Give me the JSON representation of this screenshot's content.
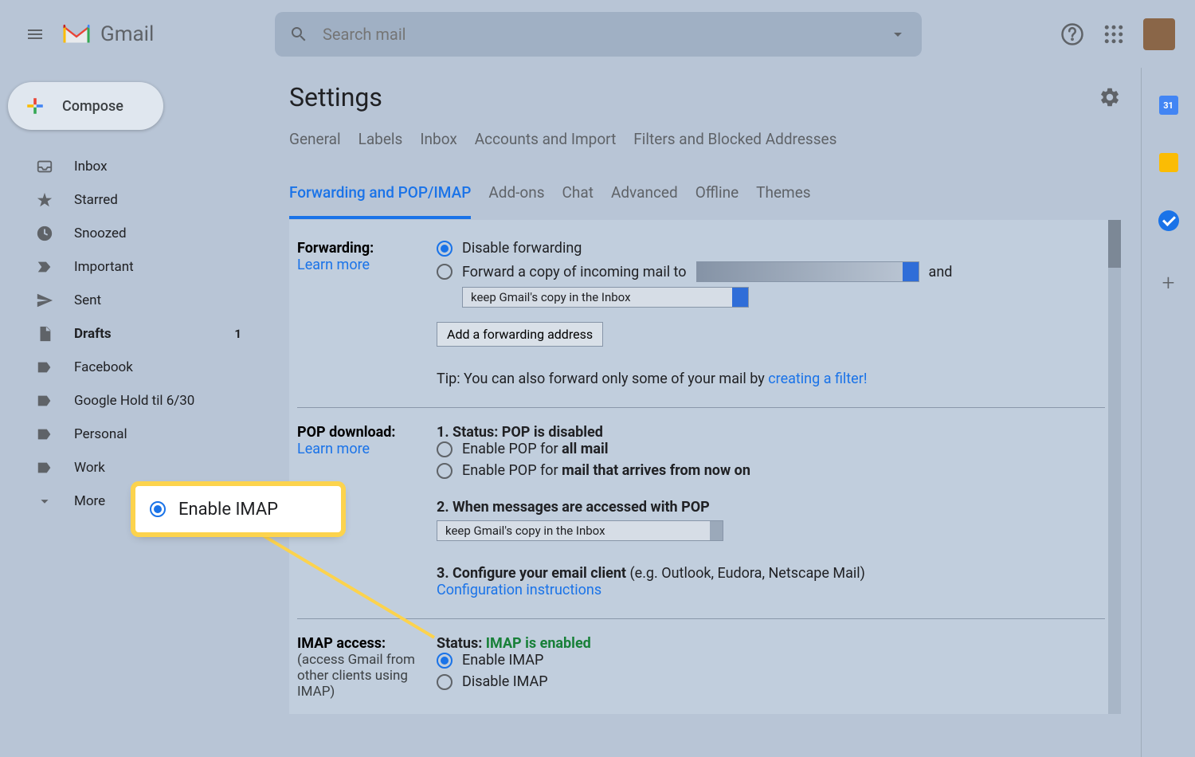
{
  "header": {
    "logo_text": "Gmail",
    "search_placeholder": "Search mail"
  },
  "sidebar": {
    "compose_label": "Compose",
    "items": [
      {
        "icon": "inbox",
        "label": "Inbox"
      },
      {
        "icon": "star",
        "label": "Starred"
      },
      {
        "icon": "clock",
        "label": "Snoozed"
      },
      {
        "icon": "important",
        "label": "Important"
      },
      {
        "icon": "sent",
        "label": "Sent"
      },
      {
        "icon": "drafts",
        "label": "Drafts",
        "count": "1",
        "bold": true
      },
      {
        "icon": "label",
        "label": "Facebook"
      },
      {
        "icon": "label",
        "label": "Google Hold til 6/30"
      },
      {
        "icon": "label",
        "label": "Personal"
      },
      {
        "icon": "label",
        "label": "Work"
      },
      {
        "icon": "chevron-down",
        "label": "More"
      }
    ]
  },
  "main": {
    "title": "Settings",
    "tabs": [
      {
        "label": "General"
      },
      {
        "label": "Labels"
      },
      {
        "label": "Inbox"
      },
      {
        "label": "Accounts and Import"
      },
      {
        "label": "Filters and Blocked Addresses"
      },
      {
        "label": "Forwarding and POP/IMAP",
        "active": true
      },
      {
        "label": "Add-ons"
      },
      {
        "label": "Chat"
      },
      {
        "label": "Advanced"
      },
      {
        "label": "Offline"
      },
      {
        "label": "Themes"
      }
    ]
  },
  "forwarding": {
    "heading": "Forwarding:",
    "learn_more": "Learn more",
    "disable_label": "Disable forwarding",
    "forward_copy_label_prefix": "Forward a copy of incoming mail to",
    "forward_and": "and",
    "keep_copy_label": "keep Gmail's copy in the Inbox",
    "add_address_btn": "Add a forwarding address",
    "tip_prefix": "Tip: You can also forward only some of your mail by ",
    "tip_link": "creating a filter!"
  },
  "pop": {
    "heading": "POP download:",
    "learn_more": "Learn more",
    "status_label": "1. Status: POP is disabled",
    "enable_all_prefix": "Enable POP for ",
    "enable_all_bold": "all mail",
    "enable_arrives_prefix": "Enable POP for ",
    "enable_arrives_bold": "mail that arrives from now on",
    "when_accessed": "2. When messages are accessed with POP",
    "keep_copy_label": "keep Gmail's copy in the Inbox",
    "configure_prefix": "3. Configure your email client ",
    "configure_suffix": "(e.g. Outlook, Eudora, Netscape Mail)",
    "config_link": "Configuration instructions"
  },
  "imap": {
    "heading": "IMAP access:",
    "subnote": "(access Gmail from other clients using IMAP)",
    "status_prefix": "Status: ",
    "status_value": "IMAP is enabled",
    "enable_label": "Enable IMAP",
    "disable_label": "Disable IMAP"
  },
  "right_rail": {
    "cal_day": "31"
  },
  "callout": {
    "label": "Enable IMAP"
  }
}
